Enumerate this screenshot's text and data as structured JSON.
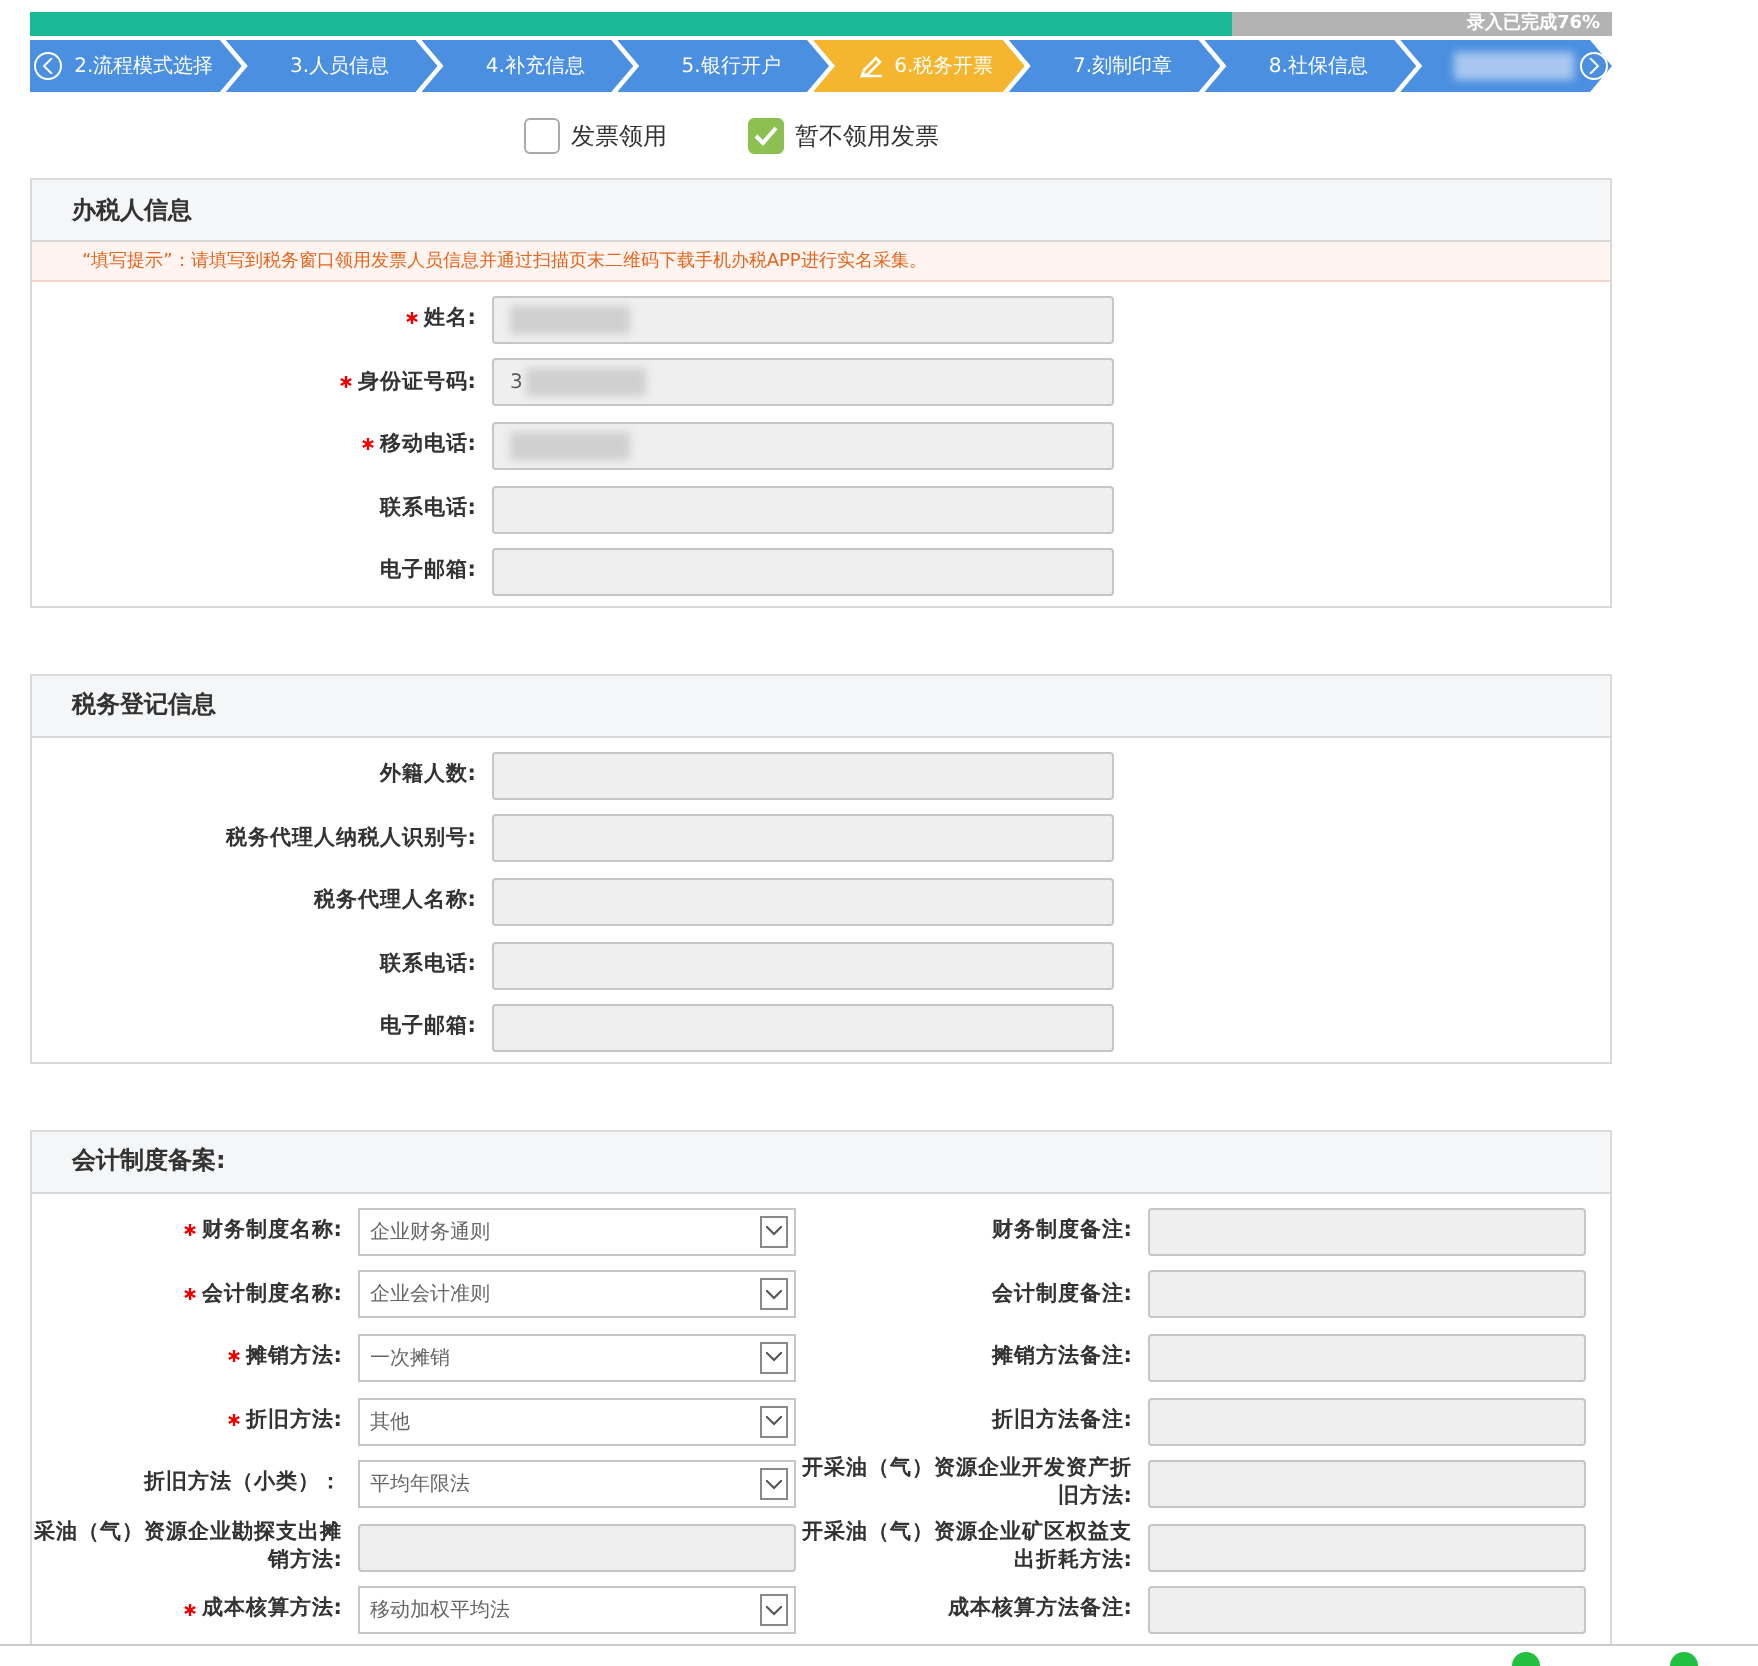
{
  "progress": {
    "level": 0.76,
    "label": "录入已完成76%"
  },
  "steps": [
    {
      "label": "2.流程模式选择",
      "selected": false
    },
    {
      "label": "3.人员信息",
      "selected": false
    },
    {
      "label": "4.补充信息",
      "selected": false
    },
    {
      "label": "5.银行开户",
      "selected": false
    },
    {
      "label": "6.税务开票",
      "selected": true
    },
    {
      "label": "7.刻制印章",
      "selected": false
    },
    {
      "label": "8.社保信息",
      "selected": false
    }
  ],
  "last_step_blurred": true,
  "invoice_options": [
    {
      "label": "发票领用",
      "checked": false
    },
    {
      "label": "暂不领用发票",
      "checked": true
    }
  ],
  "sections": [
    {
      "title": "办税人信息",
      "tip": "“填写提示”：请填写到税务窗口领用发票人员信息并通过扫描页末二维码下载手机办税APP进行实名采集。",
      "fields": [
        {
          "label": "姓名:",
          "required": true,
          "redacted": true
        },
        {
          "label": "身份证号码:",
          "required": true,
          "value": "3",
          "redacted": true
        },
        {
          "label": "移动电话:",
          "required": true,
          "redacted": true
        },
        {
          "label": "联系电话:",
          "required": false,
          "redacted": false
        },
        {
          "label": "电子邮箱:",
          "required": false,
          "redacted": false
        }
      ]
    },
    {
      "title": "税务登记信息",
      "fields": [
        {
          "label": "外籍人数:",
          "required": false,
          "redacted": false
        },
        {
          "label": "税务代理人纳税人识别号:",
          "required": false,
          "redacted": false
        },
        {
          "label": "税务代理人名称:",
          "required": false,
          "redacted": false
        },
        {
          "label": "联系电话:",
          "required": false,
          "redacted": false
        },
        {
          "label": "电子邮箱:",
          "required": false,
          "redacted": false
        }
      ]
    }
  ],
  "accounting": {
    "title": "会计制度备案:",
    "rows": [
      {
        "left": {
          "label": "财务制度名称:",
          "required": true,
          "kind": "select",
          "value": "企业财务通则"
        },
        "right": {
          "label": "财务制度备注:"
        }
      },
      {
        "left": {
          "label": "会计制度名称:",
          "required": true,
          "kind": "select",
          "value": "企业会计准则"
        },
        "right": {
          "label": "会计制度备注:"
        }
      },
      {
        "left": {
          "label": "摊销方法:",
          "required": true,
          "kind": "select",
          "value": "一次摊销"
        },
        "right": {
          "label": "摊销方法备注:"
        }
      },
      {
        "left": {
          "label": "折旧方法:",
          "required": true,
          "kind": "select",
          "value": "其他"
        },
        "right": {
          "label": "折旧方法备注:"
        }
      },
      {
        "left": {
          "label": "折旧方法（小类）：",
          "required": false,
          "kind": "select",
          "value": "平均年限法"
        },
        "right": {
          "label": "开采油（气）资源企业开发资产折旧方法:"
        }
      },
      {
        "left": {
          "label": "采油（气）资源企业勘探支出摊销方法:",
          "required": false,
          "kind": "input"
        },
        "right": {
          "label": "开采油（气）资源企业矿区权益支出折耗方法:"
        }
      },
      {
        "left": {
          "label": "成本核算方法:",
          "required": true,
          "kind": "select",
          "value": "移动加权平均法"
        },
        "right": {
          "label": "成本核算方法备注:"
        }
      }
    ]
  }
}
